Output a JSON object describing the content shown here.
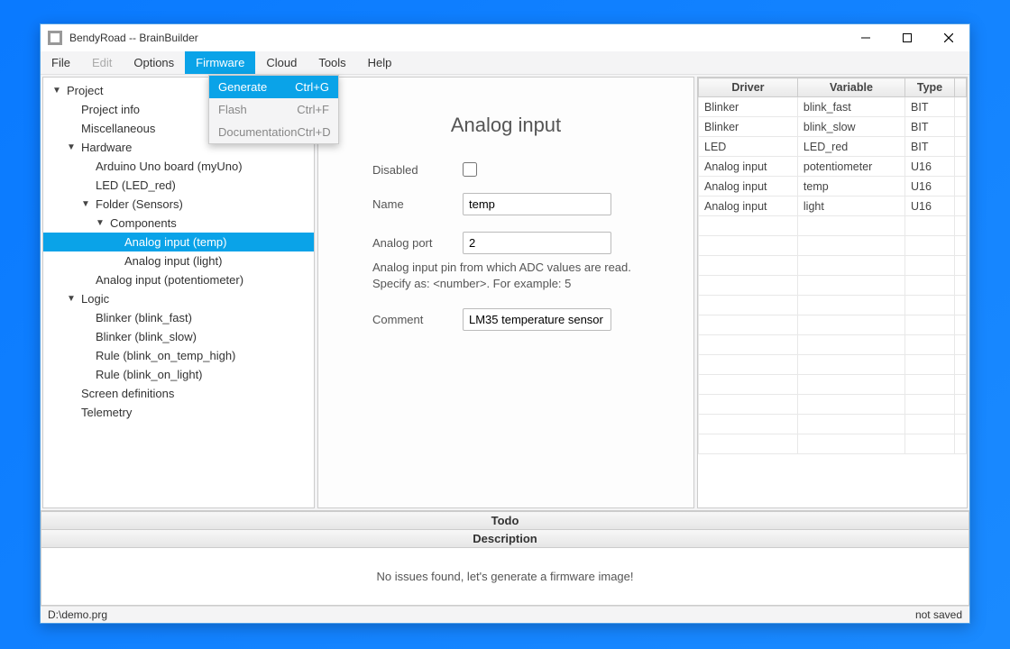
{
  "window": {
    "title": "BendyRoad -- BrainBuilder"
  },
  "menubar": {
    "items": [
      {
        "label": "File",
        "state": "normal"
      },
      {
        "label": "Edit",
        "state": "disabled"
      },
      {
        "label": "Options",
        "state": "normal"
      },
      {
        "label": "Firmware",
        "state": "active"
      },
      {
        "label": "Cloud",
        "state": "normal"
      },
      {
        "label": "Tools",
        "state": "normal"
      },
      {
        "label": "Help",
        "state": "normal"
      }
    ]
  },
  "dropdown": {
    "items": [
      {
        "label": "Generate",
        "shortcut": "Ctrl+G",
        "active": true
      },
      {
        "label": "Flash",
        "shortcut": "Ctrl+F",
        "active": false
      },
      {
        "label": "Documentation",
        "shortcut": "Ctrl+D",
        "active": false
      }
    ]
  },
  "tree": [
    {
      "indent": 0,
      "toggle": "▼",
      "label": "Project"
    },
    {
      "indent": 1,
      "toggle": "",
      "label": "Project info"
    },
    {
      "indent": 1,
      "toggle": "",
      "label": "Miscellaneous"
    },
    {
      "indent": 1,
      "toggle": "▼",
      "label": "Hardware"
    },
    {
      "indent": 2,
      "toggle": "",
      "label": "Arduino Uno board (myUno)"
    },
    {
      "indent": 2,
      "toggle": "",
      "label": "LED (LED_red)"
    },
    {
      "indent": 2,
      "toggle": "▼",
      "label": "Folder (Sensors)"
    },
    {
      "indent": 3,
      "toggle": "▼",
      "label": "Components"
    },
    {
      "indent": 4,
      "toggle": "",
      "label": "Analog input (temp)",
      "selected": true
    },
    {
      "indent": 4,
      "toggle": "",
      "label": "Analog input (light)"
    },
    {
      "indent": 2,
      "toggle": "",
      "label": "Analog input (potentiometer)"
    },
    {
      "indent": 1,
      "toggle": "▼",
      "label": "Logic"
    },
    {
      "indent": 2,
      "toggle": "",
      "label": "Blinker (blink_fast)"
    },
    {
      "indent": 2,
      "toggle": "",
      "label": "Blinker (blink_slow)"
    },
    {
      "indent": 2,
      "toggle": "",
      "label": "Rule (blink_on_temp_high)"
    },
    {
      "indent": 2,
      "toggle": "",
      "label": "Rule (blink_on_light)"
    },
    {
      "indent": 1,
      "toggle": "",
      "label": "Screen definitions"
    },
    {
      "indent": 1,
      "toggle": "",
      "label": "Telemetry"
    }
  ],
  "center": {
    "heading": "Analog input",
    "disabled_label": "Disabled",
    "name_label": "Name",
    "name_value": "temp",
    "port_label": "Analog port",
    "port_value": "2",
    "port_help": "Analog input pin from which ADC values are read. Specify as: <number>. For example: 5",
    "comment_label": "Comment",
    "comment_value": "LM35 temperature sensor"
  },
  "vars": {
    "headers": {
      "driver": "Driver",
      "variable": "Variable",
      "type": "Type"
    },
    "rows": [
      {
        "driver": "Blinker",
        "variable": "blink_fast",
        "type": "BIT"
      },
      {
        "driver": "Blinker",
        "variable": "blink_slow",
        "type": "BIT"
      },
      {
        "driver": "LED",
        "variable": "LED_red",
        "type": "BIT"
      },
      {
        "driver": "Analog input",
        "variable": "potentiometer",
        "type": "U16"
      },
      {
        "driver": "Analog input",
        "variable": "temp",
        "type": "U16"
      },
      {
        "driver": "Analog input",
        "variable": "light",
        "type": "U16"
      }
    ],
    "blank_rows": 12
  },
  "lower": {
    "todo_header": "Todo",
    "desc_header": "Description",
    "issues_text": "No issues found, let's generate a firmware image!"
  },
  "statusbar": {
    "path": "D:\\demo.prg",
    "state": "not saved"
  }
}
